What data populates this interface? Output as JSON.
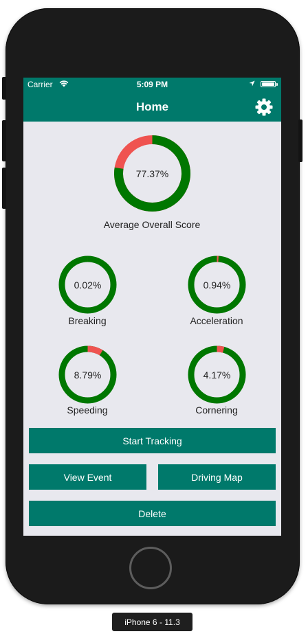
{
  "status_bar": {
    "carrier": "Carrier",
    "time": "5:09 PM"
  },
  "nav": {
    "title": "Home",
    "settings_icon": "gear-icon"
  },
  "colors": {
    "primary": "#00796b",
    "ring_good": "#007700",
    "ring_bad": "#ef5350",
    "background": "#e8e8ee"
  },
  "overall": {
    "value_text": "77.37%",
    "fraction": 0.7737,
    "label": "Average Overall Score"
  },
  "metrics": [
    {
      "value_text": "0.02%",
      "fraction": 0.0002,
      "label": "Breaking"
    },
    {
      "value_text": "0.94%",
      "fraction": 0.0094,
      "label": "Acceleration"
    },
    {
      "value_text": "8.79%",
      "fraction": 0.0879,
      "label": "Speeding"
    },
    {
      "value_text": "4.17%",
      "fraction": 0.0417,
      "label": "Cornering"
    }
  ],
  "buttons": {
    "start_tracking": "Start Tracking",
    "view_event": "View Event",
    "driving_map": "Driving Map",
    "delete": "Delete"
  },
  "device_label": "iPhone 6 - 11.3"
}
